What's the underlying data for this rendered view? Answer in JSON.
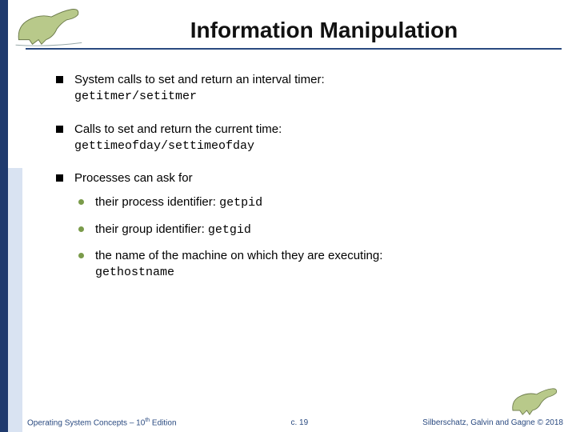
{
  "title": "Information Manipulation",
  "bullets": [
    {
      "text": "System calls to set and return an interval timer:",
      "code": "getitmer/setitmer"
    },
    {
      "text": "Calls to set and return the current time:",
      "code": "gettimeofday/settimeofday"
    },
    {
      "text": "Processes can ask for"
    }
  ],
  "subbullets": [
    {
      "text": "their process identifier: ",
      "code": "getpid"
    },
    {
      "text": "their group identifier: ",
      "code": "getgid"
    },
    {
      "text": "the name of the machine on which they are executing:",
      "code": "gethostname"
    }
  ],
  "footer": {
    "left_a": "Operating System Concepts – 10",
    "left_b": " Edition",
    "sup": "th",
    "center": "c. 19",
    "right": "Silberschatz, Galvin and Gagne © 2018"
  },
  "icons": {
    "top_dino": "dinosaur-logo",
    "bottom_dino": "dinosaur-logo-small"
  }
}
